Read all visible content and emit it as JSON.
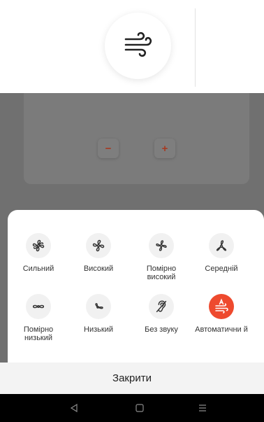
{
  "header": {
    "icon": "wind-icon"
  },
  "controls": {
    "minus": "−",
    "plus": "+"
  },
  "fan_modes": [
    {
      "label": "Сильний",
      "icon": "fan-strong-icon",
      "selected": false
    },
    {
      "label": "Високий",
      "icon": "fan-high-icon",
      "selected": false
    },
    {
      "label": "Помірно високий",
      "icon": "fan-medium-high-icon",
      "selected": false
    },
    {
      "label": "Середній",
      "icon": "fan-medium-icon",
      "selected": false
    },
    {
      "label": "Помірно низький",
      "icon": "fan-medium-low-icon",
      "selected": false
    },
    {
      "label": "Низький",
      "icon": "fan-low-icon",
      "selected": false
    },
    {
      "label": "Без звуку",
      "icon": "ear-icon",
      "selected": false
    },
    {
      "label": "Автоматични й",
      "icon": "auto-wind-icon",
      "selected": true
    }
  ],
  "close_label": "Закрити",
  "colors": {
    "accent": "#ee4a2e",
    "dim": "#707070"
  }
}
